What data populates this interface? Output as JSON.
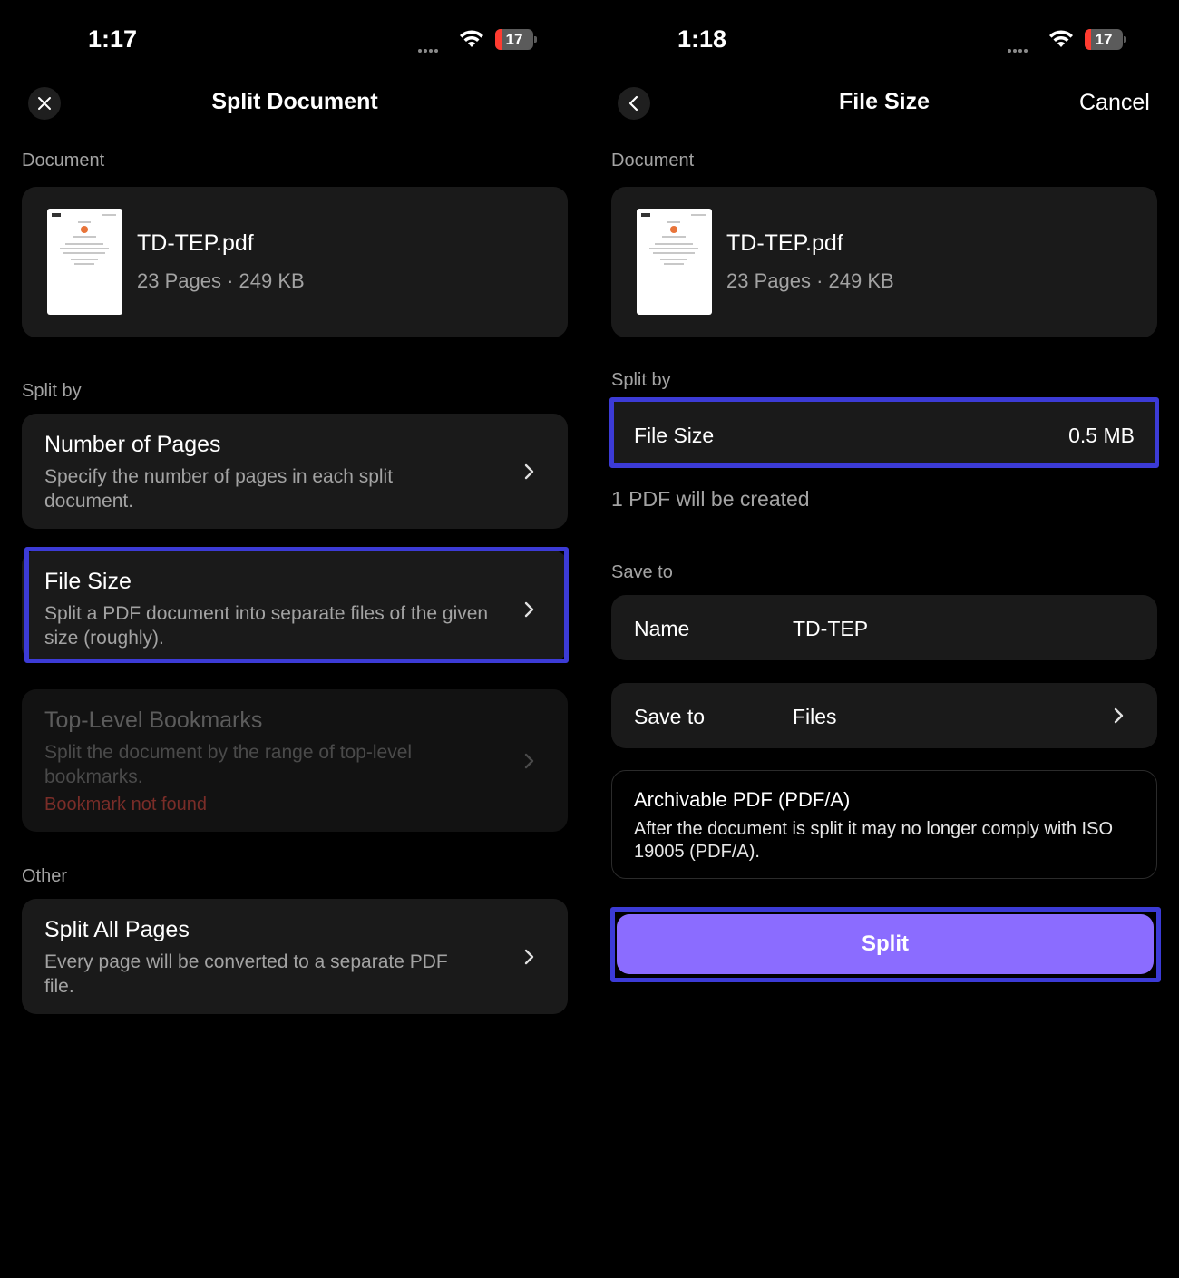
{
  "left": {
    "status": {
      "time": "1:17",
      "battery": "17"
    },
    "nav": {
      "title": "Split Document"
    },
    "document_label": "Document",
    "document": {
      "name": "TD-TEP.pdf",
      "meta": "23 Pages · 249 KB"
    },
    "split_by_label": "Split by",
    "options": [
      {
        "title": "Number of Pages",
        "desc": "Specify the number of pages in each split document."
      },
      {
        "title": "File Size",
        "desc": "Split a PDF document into separate files of the given size (roughly)."
      },
      {
        "title": "Top-Level Bookmarks",
        "desc": "Split the document by the range of top-level bookmarks.",
        "warning": "Bookmark not found"
      }
    ],
    "other_label": "Other",
    "other": {
      "title": "Split All Pages",
      "desc": "Every page will be converted to a separate PDF file."
    }
  },
  "right": {
    "status": {
      "time": "1:18",
      "battery": "17"
    },
    "nav": {
      "title": "File Size",
      "cancel": "Cancel"
    },
    "document_label": "Document",
    "document": {
      "name": "TD-TEP.pdf",
      "meta": "23 Pages · 249 KB"
    },
    "split_by_label": "Split by",
    "file_size": {
      "label": "File Size",
      "value": "0.5 MB"
    },
    "created_info": "1 PDF will be created",
    "save_to_label": "Save to",
    "name_row": {
      "label": "Name",
      "value": "TD-TEP"
    },
    "save_row": {
      "label": "Save to",
      "value": "Files"
    },
    "pdfa": {
      "title": "Archivable PDF (PDF/A)",
      "desc": "After the document is split it may no longer comply with ISO 19005 (PDF/A)."
    },
    "split_button": "Split"
  },
  "colors": {
    "background": "#000000",
    "card": "#1a1a1a",
    "highlight": "#3c3bd6",
    "accent": "#8b6cff",
    "battery_low": "#ff3b30",
    "warning": "#7a2d28"
  },
  "icons": [
    "close-icon",
    "back-chevron-icon",
    "chevron-right-icon",
    "wifi-icon",
    "battery-icon",
    "signal-dots-icon",
    "pdf-thumbnail"
  ]
}
